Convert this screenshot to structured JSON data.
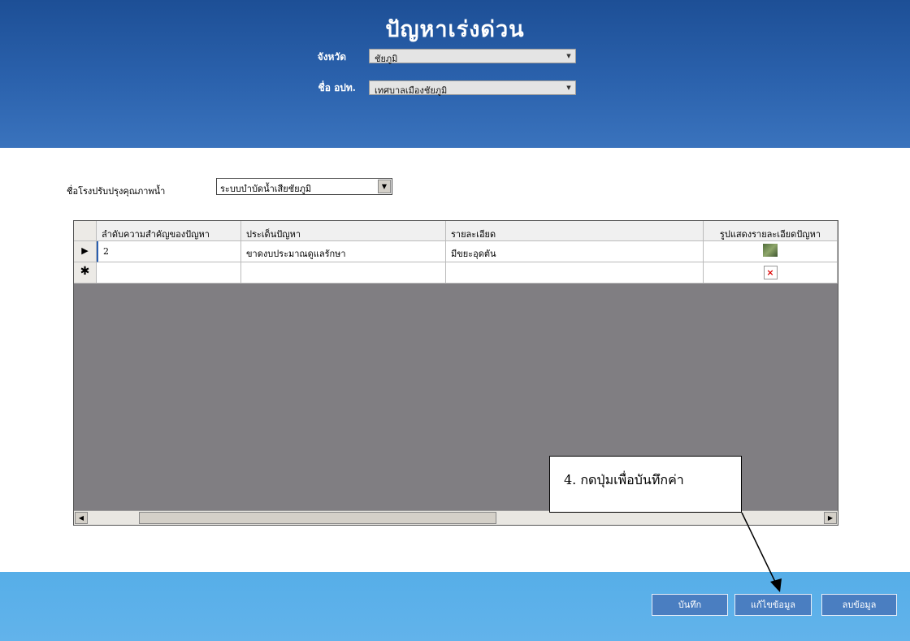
{
  "header": {
    "title": "ปัญหาเร่งด่วน",
    "province_label": "จังหวัด",
    "province_value": "ชัยภูมิ",
    "org_label": "ชื่อ อปท.",
    "org_value": "เทศบาลเมืองชัยภูมิ"
  },
  "plant": {
    "label": "ชื่อโรงปรับปรุงคุณภาพน้ำ",
    "value": "ระบบบำบัดน้ำเสียชัยภูมิ"
  },
  "grid": {
    "columns": [
      "ลำดับความสำคัญของปัญหา",
      "ประเด็นปัญหา",
      "รายละเอียด",
      "รูปแสดงรายละเอียดปัญหา"
    ],
    "rows": [
      {
        "indicator": "▶",
        "priority": "2",
        "issue": "ขาดงบประมาณดูแลรักษา",
        "detail": "มีขยะอุดตัน",
        "image": "photo-thumbnail"
      }
    ],
    "new_row_indicator": "✱",
    "new_row_image": "broken-image-icon"
  },
  "callout": {
    "text": "4. กดปุ่มเพื่อบันทึกค่า"
  },
  "buttons": {
    "save": "บันทึก",
    "edit": "แก้ไขข้อมูล",
    "delete": "ลบข้อมูล"
  },
  "colors": {
    "header_bg": "#2b62ad",
    "footer_bg": "#5eb1ea",
    "button_bg": "#4a7ec1",
    "grid_bg": "#807e82"
  }
}
